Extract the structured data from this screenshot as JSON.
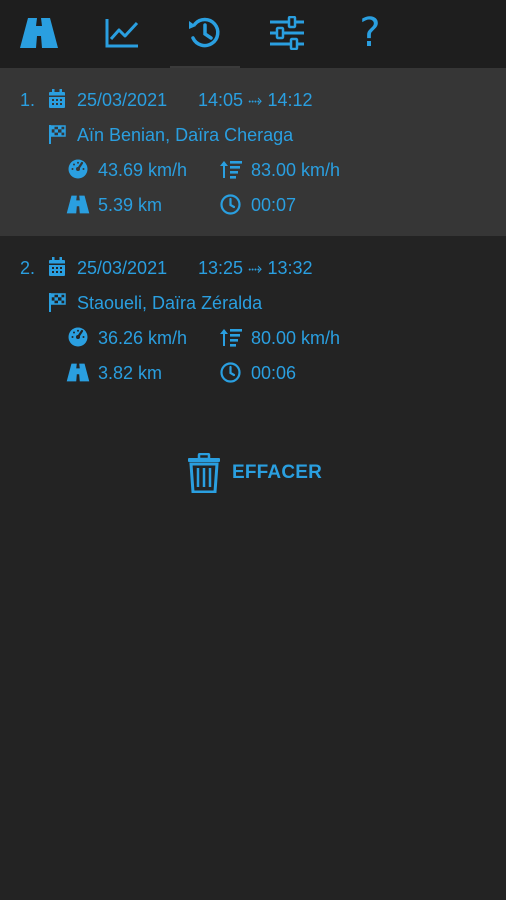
{
  "tabs": [
    {
      "name": "road-icon"
    },
    {
      "name": "chart-icon"
    },
    {
      "name": "history-icon",
      "active": true
    },
    {
      "name": "settings-sliders-icon"
    },
    {
      "name": "help-icon",
      "label": "?"
    }
  ],
  "trips": [
    {
      "index": "1.",
      "date": "25/03/2021",
      "time_range": "14:05 ⤑ 14:12",
      "location": "Aïn Benian, Daïra Cheraga",
      "avg_speed": "43.69 km/h",
      "max_speed": "83.00 km/h",
      "distance": "5.39 km",
      "duration": "00:07",
      "selected": true
    },
    {
      "index": "2.",
      "date": "25/03/2021",
      "time_range": "13:25 ⤑ 13:32",
      "location": "Staoueli, Daïra Zéralda",
      "avg_speed": "36.26 km/h",
      "max_speed": "80.00 km/h",
      "distance": "3.82 km",
      "duration": "00:06",
      "selected": false
    }
  ],
  "erase_button": {
    "label": "EFFACER",
    "icon": "trash-icon"
  },
  "colors": {
    "accent": "#2a9fe0",
    "background": "#232323",
    "selected_row": "#363636",
    "topbar": "#1e1e1e"
  }
}
